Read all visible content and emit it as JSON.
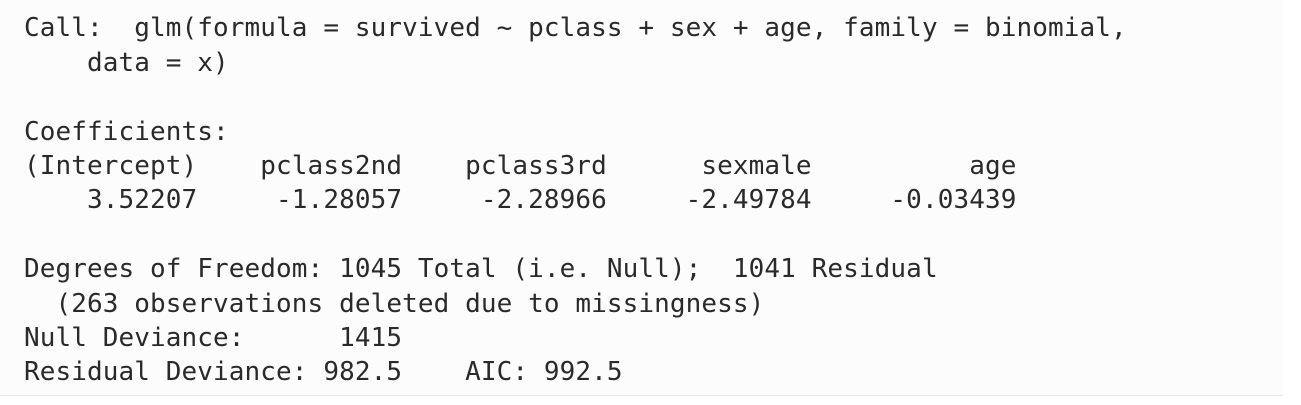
{
  "output": {
    "call_line_1": "Call:  glm(formula = survived ~ pclass + sex + age, family = binomial,",
    "call_line_2": "    data = x)",
    "coefficients_header": "Coefficients:",
    "coefficients_names": "(Intercept)    pclass2nd    pclass3rd      sexmale          age",
    "coefficients_values": "    3.52207     -1.28057     -2.28966     -2.49784     -0.03439",
    "dof_line": "Degrees of Freedom: 1045 Total (i.e. Null);  1041 Residual",
    "missing_line": "  (263 observations deleted due to missingness)",
    "null_deviance_line": "Null Deviance:      1415",
    "residual_deviance_line": "Residual Deviance: 982.5    AIC: 992.5"
  }
}
